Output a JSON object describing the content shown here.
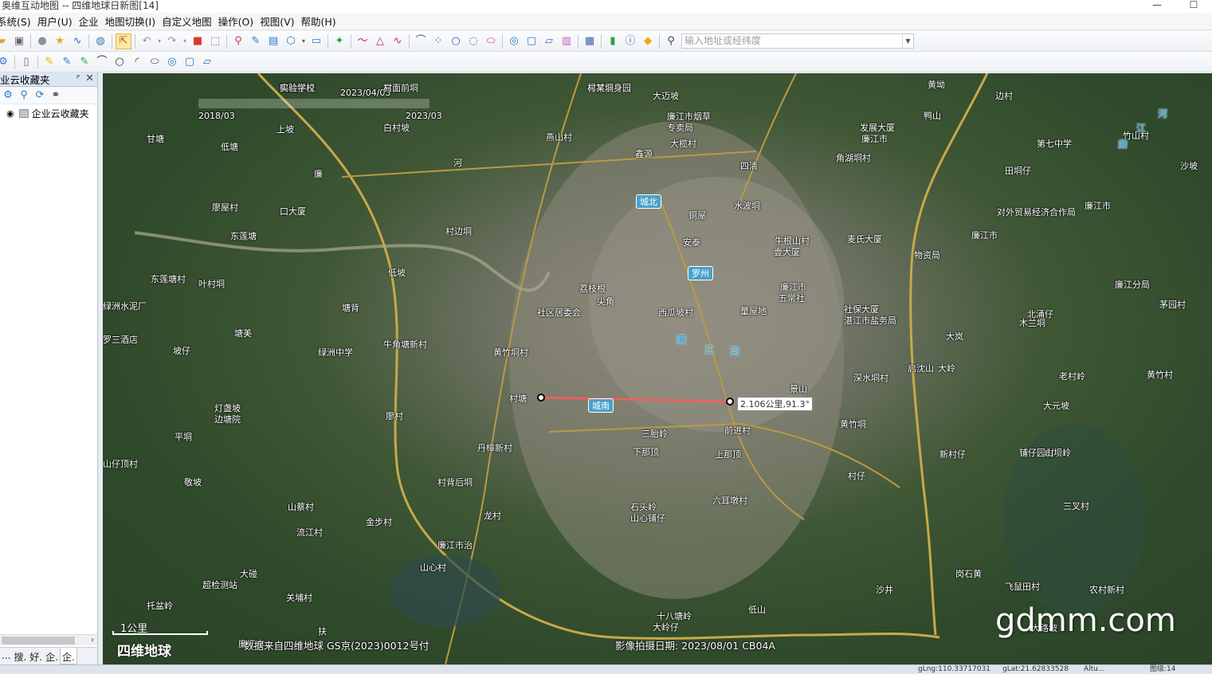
{
  "window": {
    "title": "奥维互动地图 -- 四维地球日新图[14]",
    "min": "—",
    "max": "☐"
  },
  "menu": [
    "系统(S)",
    "用户(U)",
    "企业",
    "地图切换(I)",
    "自定义地图",
    "操作(O)",
    "视图(V)",
    "帮助(H)"
  ],
  "search": {
    "placeholder": "输入地址或经纬度"
  },
  "left_panel": {
    "title": "业云收藏夹",
    "pin": "ᴾ",
    "close": "✕",
    "tree_root": "企业云收藏夹",
    "tabs": [
      "...",
      "搜.",
      "好.",
      "企.",
      "企."
    ],
    "scroll_arrow": "›"
  },
  "map": {
    "dates": [
      "2023/04/03",
      "2018/03",
      "2023/03"
    ],
    "districts": [
      "城北",
      "罗州",
      "城南"
    ],
    "river_chars": [
      "廉",
      "江",
      "河",
      "河",
      "江",
      "廉"
    ],
    "labels": [
      "鹤岭仔村",
      "高山",
      "樟村健身园",
      "大迈坡",
      "上坡",
      "白村坡",
      "廉江市烟草",
      "专卖局",
      "鸭山",
      "黄坳",
      "边村",
      "甘塘",
      "低塘",
      "燕山村",
      "大榄村",
      "鑫源",
      "发展大厦",
      "廉江市",
      "第七中学",
      "四清",
      "角湖垌村",
      "田垌仔",
      "竹山村",
      "沙坡",
      "廉",
      "河",
      "廖屋村",
      "口大厦",
      "水波垌",
      "铜屋",
      "廉江市",
      "对外贸易经济合作局",
      "东莲塘",
      "村边垌",
      "安泰",
      "牛根山村",
      "壹大厦",
      "麦氏大厦",
      "廉江市",
      "物资局",
      "东莲塘村",
      "叶村垌",
      "低坡",
      "荔枝根",
      "尖角",
      "西瓜坡村",
      "廉江市",
      "五常社",
      "社保大厦",
      "湛江市盐务局",
      "廉江分局",
      "绿洲水泥厂",
      "社区居委会",
      "量屋地",
      "北涌仔",
      "茅园村",
      "罗三酒店",
      "塘美",
      "塘背",
      "大岚",
      "木兰垌",
      "坡仔",
      "绿洲中学",
      "牛角塘新村",
      "黄竹垌村",
      "大岭",
      "老村岭",
      "深水垌村",
      "启沈山",
      "黄竹村",
      "村塘",
      "景山",
      "大元坡",
      "平垌",
      "灯盏坡",
      "边塘院",
      "廖村",
      "丹樟新村",
      "黄竹垌",
      "新村仔",
      "铺仔园村",
      "山坝岭",
      "前进村",
      "山仔顶村",
      "三胎岭",
      "村背后垌",
      "下那顶",
      "上那顶",
      "村仔",
      "敬坡",
      "六耳墩村",
      "山蔡村",
      "金步村",
      "龙村",
      "石头岭",
      "山心铺仔",
      "三叉村",
      "流江村",
      "廉江市治",
      "超检测站",
      "大碰",
      "山心村",
      "关埔村",
      "托盆岭",
      "岗石黄",
      "沙井",
      "低山",
      "大路坡",
      "飞鼠田村",
      "农村新村",
      "十八塘岭",
      "大岭仔",
      "扶",
      "廉江市",
      "实验学校",
      "村面前垌",
      "村某垌"
    ],
    "measure": "2.106公里,91.3°",
    "scale": "1公里",
    "brand": "四维地球",
    "source": "数据来自四维地球 GS京(2023)0012号付",
    "capture_date": "影像拍摄日期: 2023/08/01 CB04A",
    "watermark": "gdmm.com"
  },
  "status": {
    "lng": "gLng:110.33717031",
    "lat": "gLat:21.62833528",
    "alt": "Altu...",
    "zoom": "图级:14"
  }
}
